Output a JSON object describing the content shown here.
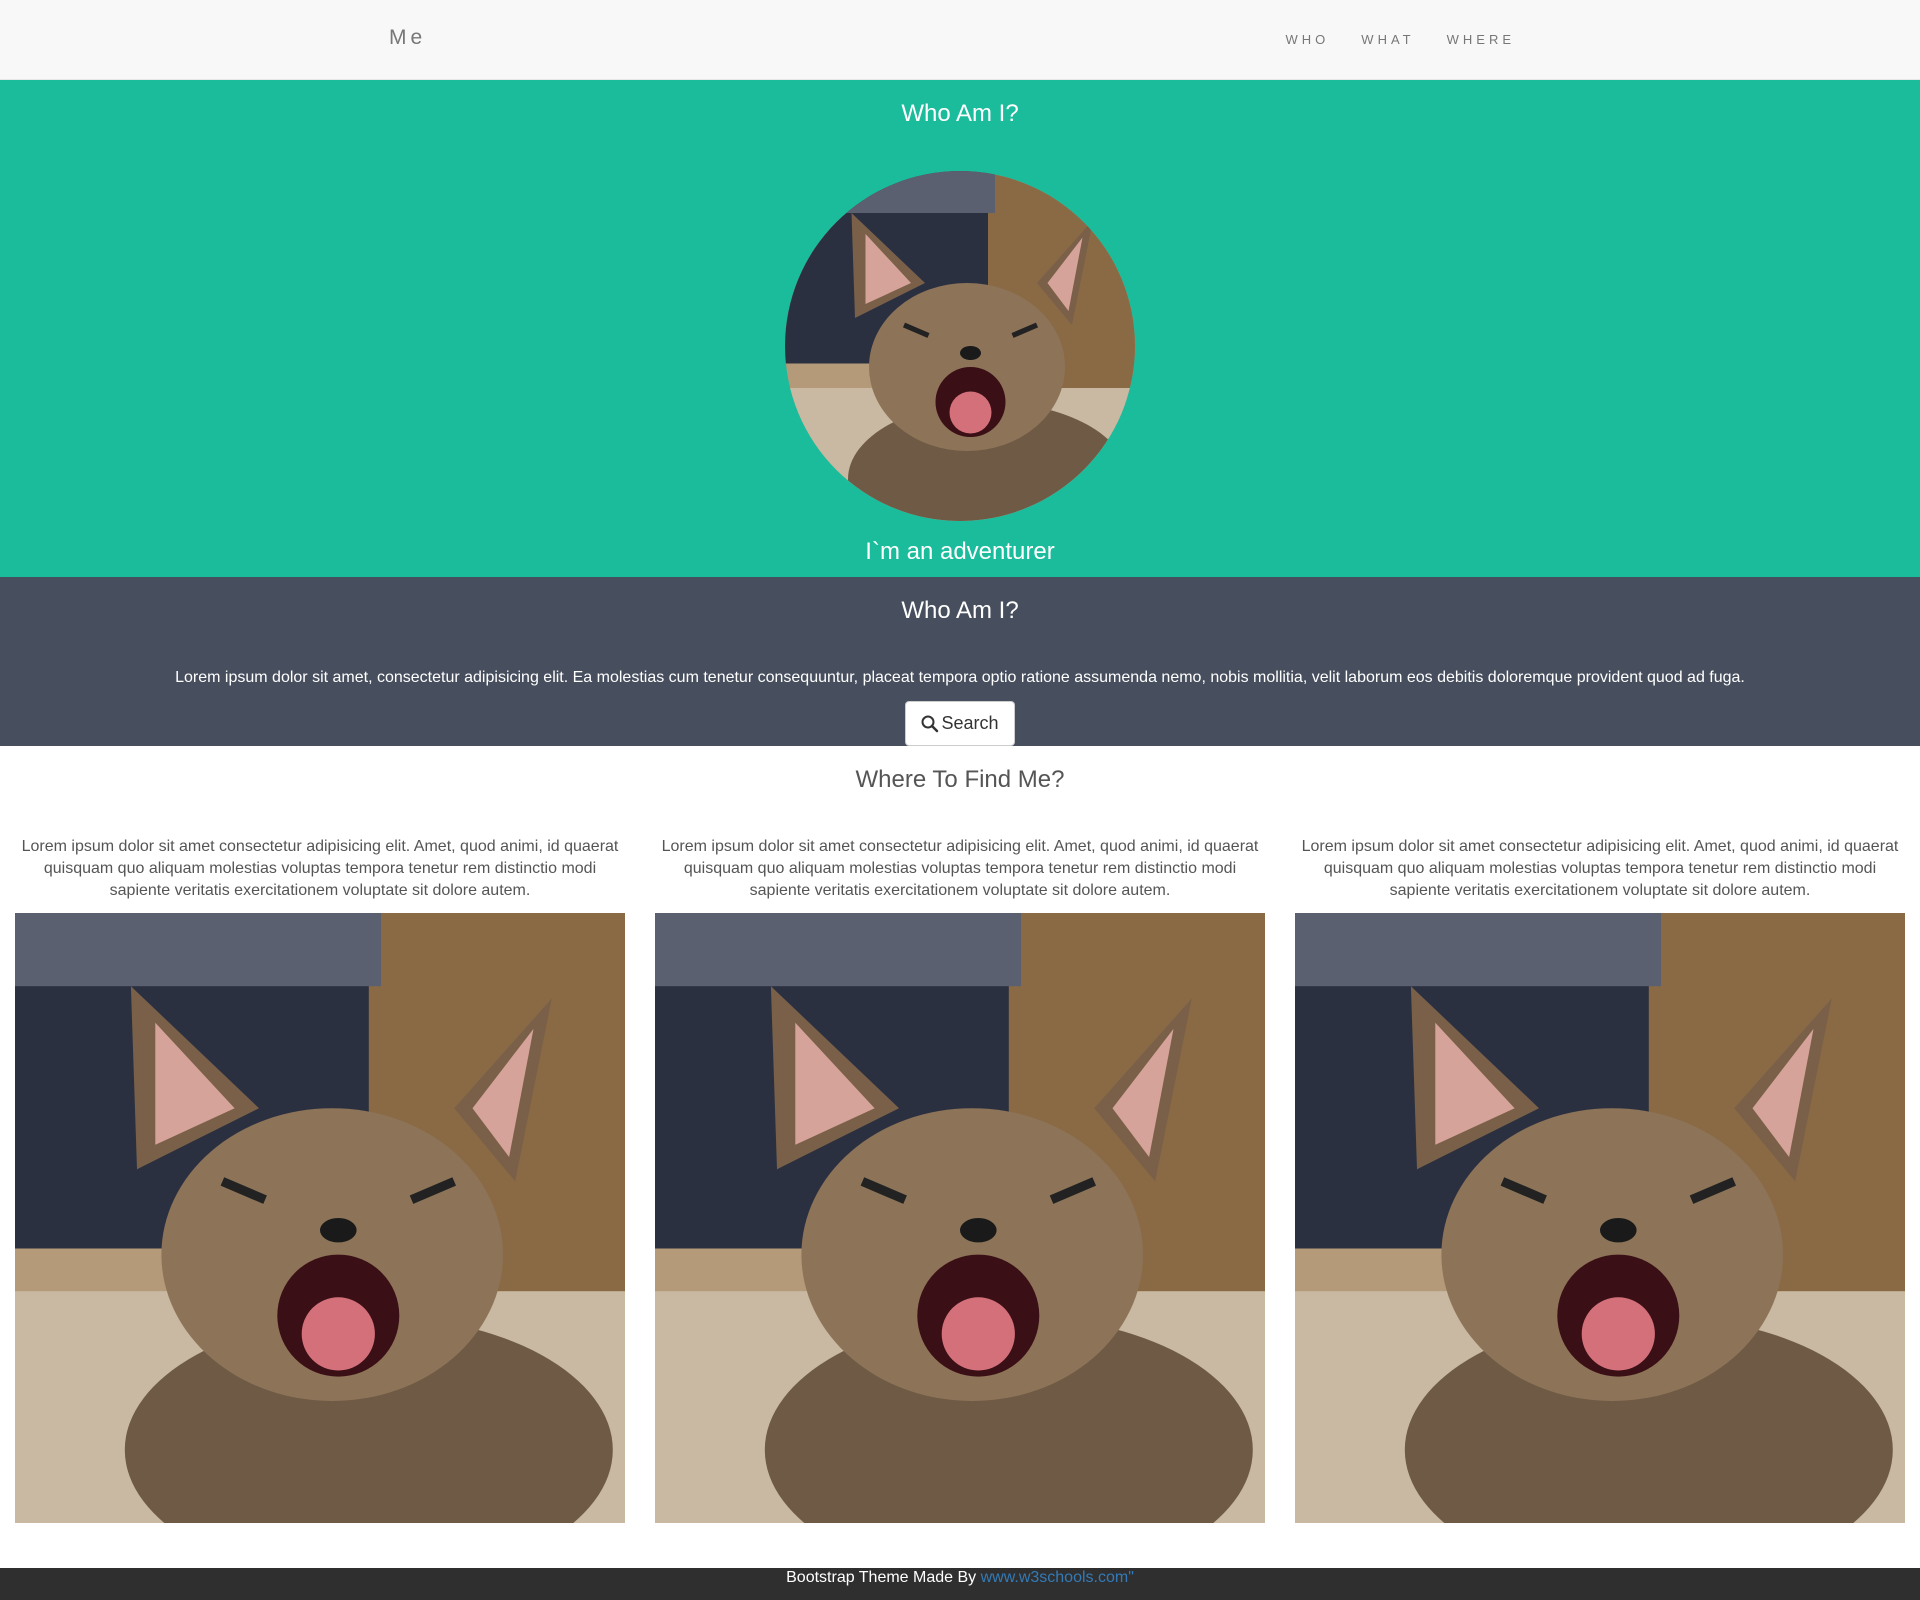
{
  "navbar": {
    "brand": "Me",
    "links": [
      {
        "label": "WHO"
      },
      {
        "label": "WHAT"
      },
      {
        "label": "WHERE"
      }
    ]
  },
  "hero": {
    "title": "Who Am I?",
    "subtitle": "I`m an adventurer",
    "avatar_icon": "kitten-photo"
  },
  "about": {
    "title": "Who Am I?",
    "text": "Lorem ipsum dolor sit amet, consectetur adipisicing elit. Ea molestias cum tenetur consequuntur, placeat tempora optio ratione assumenda nemo, nobis mollitia, velit laborum eos debitis doloremque provident quod ad fuga.",
    "search_label": "Search",
    "search_icon": "search-icon"
  },
  "where": {
    "title": "Where To Find Me?",
    "columns": [
      {
        "text": "Lorem ipsum dolor sit amet consectetur adipisicing elit. Amet, quod animi, id quaerat quisquam quo aliquam molestias voluptas tempora tenetur rem distinctio modi sapiente veritatis exercitationem voluptate sit dolore autem."
      },
      {
        "text": "Lorem ipsum dolor sit amet consectetur adipisicing elit. Amet, quod animi, id quaerat quisquam quo aliquam molestias voluptas tempora tenetur rem distinctio modi sapiente veritatis exercitationem voluptate sit dolore autem."
      },
      {
        "text": "Lorem ipsum dolor sit amet consectetur adipisicing elit. Amet, quod animi, id quaerat quisquam quo aliquam molestias voluptas tempora tenetur rem distinctio modi sapiente veritatis exercitationem voluptate sit dolore autem."
      }
    ]
  },
  "footer": {
    "text": "Bootstrap Theme Made By ",
    "link_text": "www.w3schools.com\""
  },
  "colors": {
    "hero_bg": "#1abc9c",
    "about_bg": "#474e5d",
    "footer_bg": "#2f2f2f",
    "navbar_bg": "#f8f8f8",
    "link": "#337ab7"
  }
}
